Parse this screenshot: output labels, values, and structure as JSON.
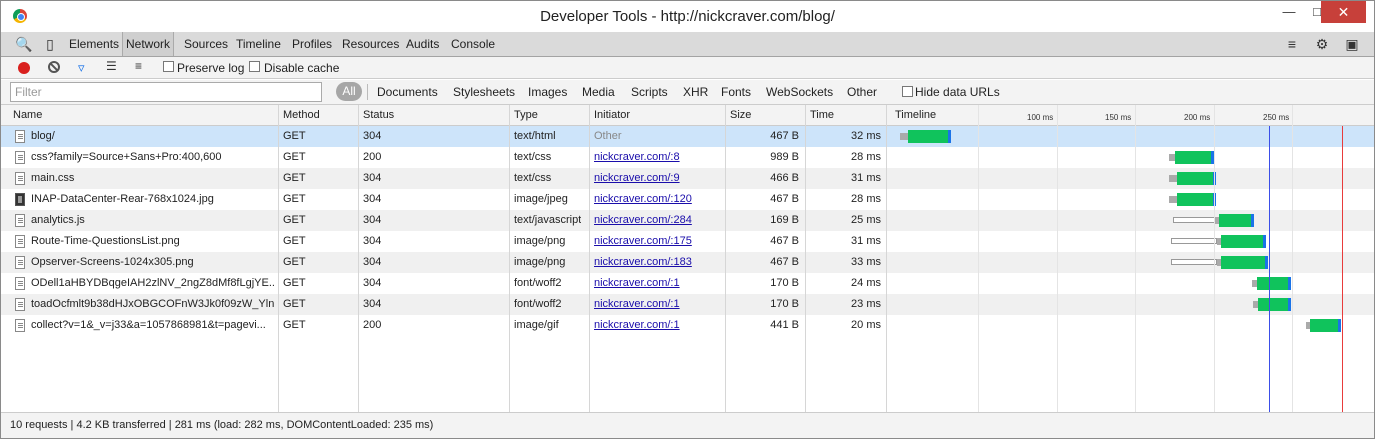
{
  "window": {
    "title": "Developer Tools - http://nickcraver.com/blog/"
  },
  "tabs": [
    "Elements",
    "Network",
    "Sources",
    "Timeline",
    "Profiles",
    "Resources",
    "Audits",
    "Console"
  ],
  "active_tab": "Network",
  "network_toolbar": {
    "preserve_log": "Preserve log",
    "disable_cache": "Disable cache"
  },
  "filter": {
    "placeholder": "Filter",
    "all_label": "All",
    "types": [
      "Documents",
      "Stylesheets",
      "Images",
      "Media",
      "Scripts",
      "XHR",
      "Fonts",
      "WebSockets",
      "Other"
    ],
    "hide_data_urls": "Hide data URLs"
  },
  "columns": [
    "Name",
    "Method",
    "Status",
    "Type",
    "Initiator",
    "Size",
    "Time",
    "Timeline"
  ],
  "timeline_ticks": [
    "100 ms",
    "150 ms",
    "200 ms",
    "250 ms"
  ],
  "rows": [
    {
      "name": "blog/",
      "method": "GET",
      "status": "304",
      "type": "text/html",
      "initiator": "Other",
      "size": "467 B",
      "time": "32 ms"
    },
    {
      "name": "css?family=Source+Sans+Pro:400,600",
      "method": "GET",
      "status": "200",
      "type": "text/css",
      "initiator": "nickcraver.com/:8",
      "size": "989 B",
      "time": "28 ms"
    },
    {
      "name": "main.css",
      "method": "GET",
      "status": "304",
      "type": "text/css",
      "initiator": "nickcraver.com/:9",
      "size": "466 B",
      "time": "31 ms"
    },
    {
      "name": "INAP-DataCenter-Rear-768x1024.jpg",
      "method": "GET",
      "status": "304",
      "type": "image/jpeg",
      "initiator": "nickcraver.com/:120",
      "size": "467 B",
      "time": "28 ms"
    },
    {
      "name": "analytics.js",
      "method": "GET",
      "status": "304",
      "type": "text/javascript",
      "initiator": "nickcraver.com/:284",
      "size": "169 B",
      "time": "25 ms"
    },
    {
      "name": "Route-Time-QuestionsList.png",
      "method": "GET",
      "status": "304",
      "type": "image/png",
      "initiator": "nickcraver.com/:175",
      "size": "467 B",
      "time": "31 ms"
    },
    {
      "name": "Opserver-Screens-1024x305.png",
      "method": "GET",
      "status": "304",
      "type": "image/png",
      "initiator": "nickcraver.com/:183",
      "size": "467 B",
      "time": "33 ms"
    },
    {
      "name": "ODell1aHBYDBqgeIAH2zlNV_2ngZ8dMf8fLgjYE...",
      "method": "GET",
      "status": "304",
      "type": "font/woff2",
      "initiator": "nickcraver.com/:1",
      "size": "170 B",
      "time": "24 ms"
    },
    {
      "name": "toadOcfmlt9b38dHJxOBGCOFnW3Jk0f09zW_Yln...",
      "method": "GET",
      "status": "304",
      "type": "font/woff2",
      "initiator": "nickcraver.com/:1",
      "size": "170 B",
      "time": "23 ms"
    },
    {
      "name": "collect?v=1&_v=j33&a=1057868981&t=pagevi...",
      "method": "GET",
      "status": "200",
      "type": "image/gif",
      "initiator": "nickcraver.com/:1",
      "size": "441 B",
      "time": "20 ms"
    }
  ],
  "status_bar": "10 requests | 4.2 KB transferred | 281 ms (load: 282 ms, DOMContentLoaded: 235 ms)"
}
